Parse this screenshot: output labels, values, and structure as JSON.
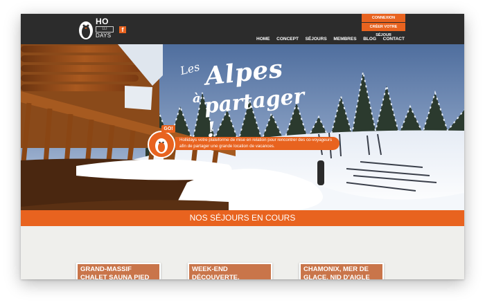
{
  "header": {
    "logo": {
      "top": "HO",
      "middle": "LLI",
      "bottom": "DAYS"
    },
    "facebook_label": "f",
    "login_label": "CONNEXION",
    "create_label": "CRÉER VOTRE SÉJOUR",
    "nav": [
      "HOME",
      "CONCEPT",
      "SÉJOURS",
      "MEMBRES",
      "BLOG",
      "CONTACT"
    ]
  },
  "hero": {
    "title_les": "Les",
    "title_alpes": "Alpes",
    "title_a": "à",
    "title_partager": "partager !",
    "go_label": "GO!",
    "callout": "Hollidays votre plateforme de mise en relation pour rencontrer des co-voyageurs afin de partager une grande location de vacances."
  },
  "section": {
    "title": "NOS SÉJOURS EN COURS",
    "cards": [
      "GRAND-MASSIF CHALET SAUNA PIED",
      "WEEK-END DÉCOUVERTE,",
      "CHAMONIX, MER DE GLACE, NID D'AIGLE"
    ]
  },
  "colors": {
    "accent": "#e8631f",
    "header_bg": "#2c2c2c"
  }
}
